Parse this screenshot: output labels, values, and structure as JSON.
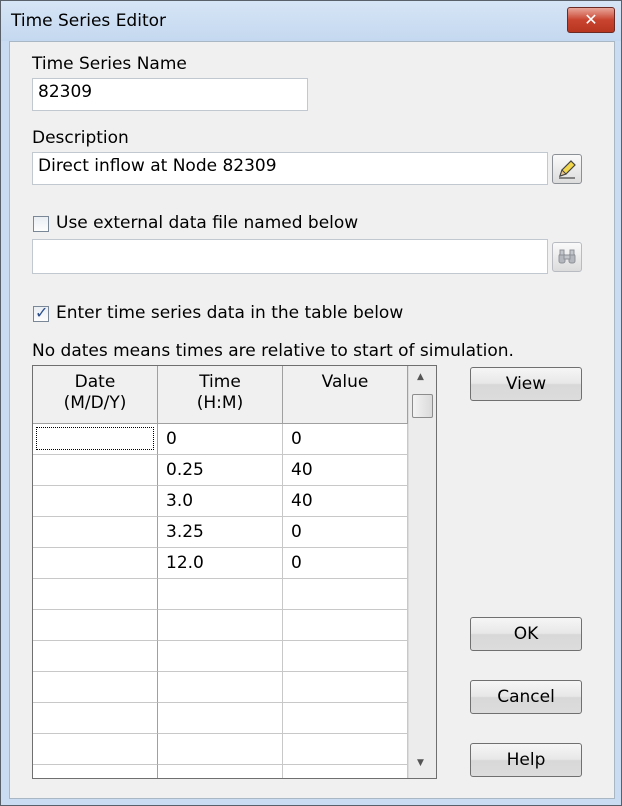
{
  "window": {
    "title": "Time Series Editor",
    "close_label": "✕"
  },
  "name_field": {
    "label": "Time Series Name",
    "value": "82309"
  },
  "description_field": {
    "label": "Description",
    "value": "Direct inflow at Node 82309"
  },
  "external_file": {
    "checkbox_label": "Use external data file named below",
    "checked": false,
    "value": ""
  },
  "table_option": {
    "checkbox_label": "Enter time series data in the table below",
    "checked": true
  },
  "note": "No dates means times are relative to start of simulation.",
  "table": {
    "headers": [
      {
        "line1": "Date",
        "line2": "(M/D/Y)"
      },
      {
        "line1": "Time",
        "line2": "(H:M)"
      },
      {
        "line1": "",
        "line2": "Value"
      }
    ],
    "rows": [
      {
        "date": "",
        "time": "0",
        "value": "0"
      },
      {
        "date": "",
        "time": "0.25",
        "value": "40"
      },
      {
        "date": "",
        "time": "3.0",
        "value": "40"
      },
      {
        "date": "",
        "time": "3.25",
        "value": "0"
      },
      {
        "date": "",
        "time": "12.0",
        "value": "0"
      },
      {
        "date": "",
        "time": "",
        "value": ""
      },
      {
        "date": "",
        "time": "",
        "value": ""
      },
      {
        "date": "",
        "time": "",
        "value": ""
      },
      {
        "date": "",
        "time": "",
        "value": ""
      },
      {
        "date": "",
        "time": "",
        "value": ""
      },
      {
        "date": "",
        "time": "",
        "value": ""
      },
      {
        "date": "",
        "time": "",
        "value": ""
      }
    ]
  },
  "buttons": {
    "view": "View",
    "ok": "OK",
    "cancel": "Cancel",
    "help": "Help"
  },
  "icons": {
    "description_editor": "edit-pencil-icon",
    "file_browser": "binoculars-icon"
  }
}
